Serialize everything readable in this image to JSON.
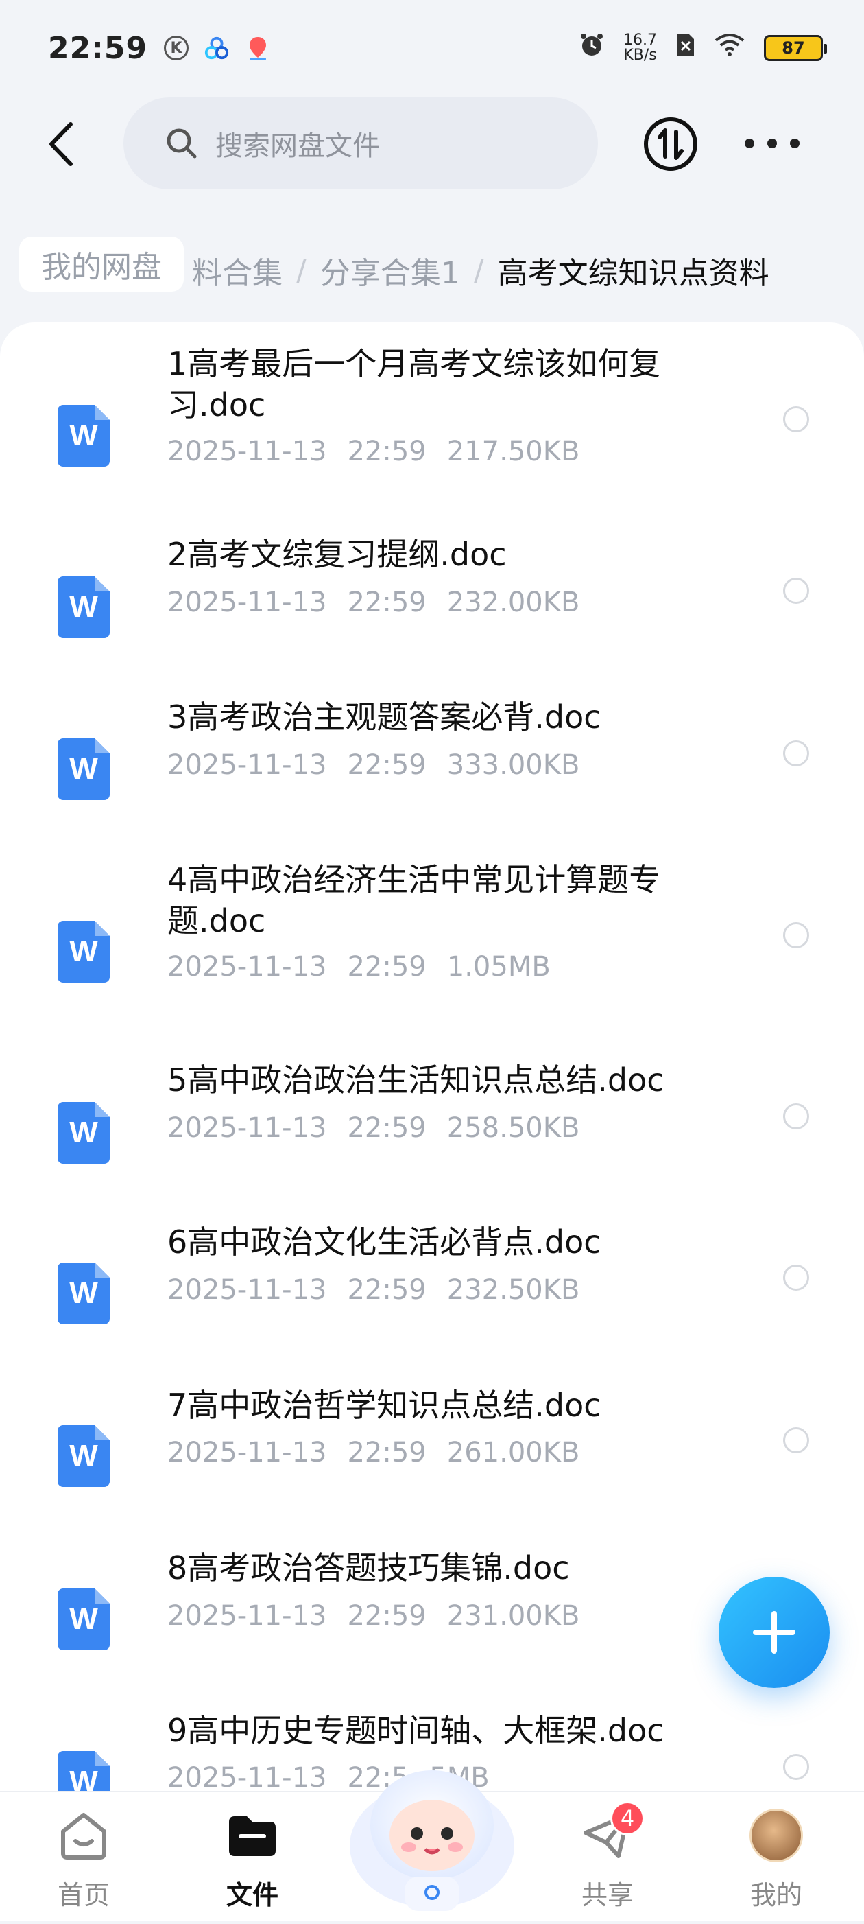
{
  "status_bar": {
    "time": "22:59",
    "net_speed_value": "16.7",
    "net_speed_unit": "KB/s",
    "battery": "87",
    "icons": [
      "k-circle-icon",
      "cloud-app-icon",
      "map-pin-icon",
      "alarm-icon",
      "sim-off-icon",
      "wifi-icon"
    ]
  },
  "header": {
    "search_placeholder": "搜索网盘文件",
    "icons": [
      "back-arrow-icon",
      "search-icon",
      "transfer-icon",
      "more-icon"
    ]
  },
  "breadcrumb": {
    "root": "我的网盘",
    "trail": [
      "料合集",
      "分享合集1"
    ],
    "separator": "/",
    "current": "高考文综知识点资料"
  },
  "files": [
    {
      "name": "1高考最后一个月高考文综该如何复习.doc",
      "date": "2025-11-13",
      "time": "22:59",
      "size": "217.50KB"
    },
    {
      "name": "2高考文综复习提纲.doc",
      "date": "2025-11-13",
      "time": "22:59",
      "size": "232.00KB"
    },
    {
      "name": "3高考政治主观题答案必背.doc",
      "date": "2025-11-13",
      "time": "22:59",
      "size": "333.00KB"
    },
    {
      "name": "4高中政治经济生活中常见计算题专题.doc",
      "date": "2025-11-13",
      "time": "22:59",
      "size": "1.05MB"
    },
    {
      "name": "5高中政治政治生活知识点总结.doc",
      "date": "2025-11-13",
      "time": "22:59",
      "size": "258.50KB"
    },
    {
      "name": "6高中政治文化生活必背点.doc",
      "date": "2025-11-13",
      "time": "22:59",
      "size": "232.50KB"
    },
    {
      "name": "7高中政治哲学知识点总结.doc",
      "date": "2025-11-13",
      "time": "22:59",
      "size": "261.00KB"
    },
    {
      "name": "8高考政治答题技巧集锦.doc",
      "date": "2025-11-13",
      "time": "22:59",
      "size": "231.00KB"
    },
    {
      "name": "9高中历史专题时间轴、大框架.doc",
      "date": "2025-11-13",
      "time": "22:5",
      "size": "5MB"
    }
  ],
  "file_icon_letter": "W",
  "bottom_nav": {
    "items": [
      {
        "label": "首页",
        "icon": "home-icon",
        "active": false
      },
      {
        "label": "文件",
        "icon": "folder-icon",
        "active": true
      },
      {
        "label": "",
        "icon": "mascot-icon",
        "active": false
      },
      {
        "label": "共享",
        "icon": "paper-plane-icon",
        "active": false,
        "badge": "4"
      },
      {
        "label": "我的",
        "icon": "avatar-icon",
        "active": false
      }
    ]
  },
  "colors": {
    "accent": "#3a86f2",
    "fab": "#1a8df0",
    "badge": "#ff4d5a",
    "battery": "#f7c61a"
  }
}
